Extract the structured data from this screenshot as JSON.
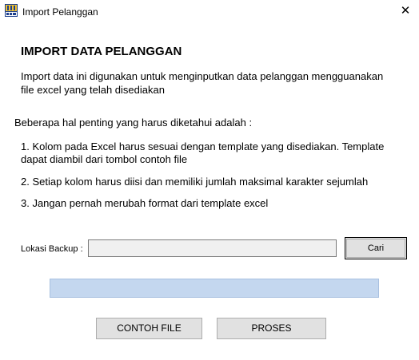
{
  "window": {
    "title": "Import Pelanggan",
    "icon": "pos-app-icon",
    "close_glyph": "✕"
  },
  "content": {
    "heading": "IMPORT DATA PELANGGAN",
    "intro": "Import data ini digunakan untuk menginputkan data pelanggan mengguanakan file excel yang telah disediakan",
    "subheading": "Beberapa hal penting yang harus diketahui adalah :",
    "notes": [
      "1. Kolom pada Excel harus sesuai dengan template yang disediakan. Template dapat diambil dari tombol contoh file",
      "2. Setiap kolom harus diisi dan memiliki jumlah maksimal karakter sejumlah",
      "3. Jangan pernah merubah format dari template excel"
    ]
  },
  "backup": {
    "label": "Lokasi Backup :",
    "value": "",
    "browse_label": "Cari"
  },
  "progress": {
    "value": 0
  },
  "actions": {
    "contoh_label": "CONTOH FILE",
    "proses_label": "PROSES"
  },
  "colors": {
    "progress_track": "#c4d7ef",
    "button_face": "#e1e1e1"
  }
}
